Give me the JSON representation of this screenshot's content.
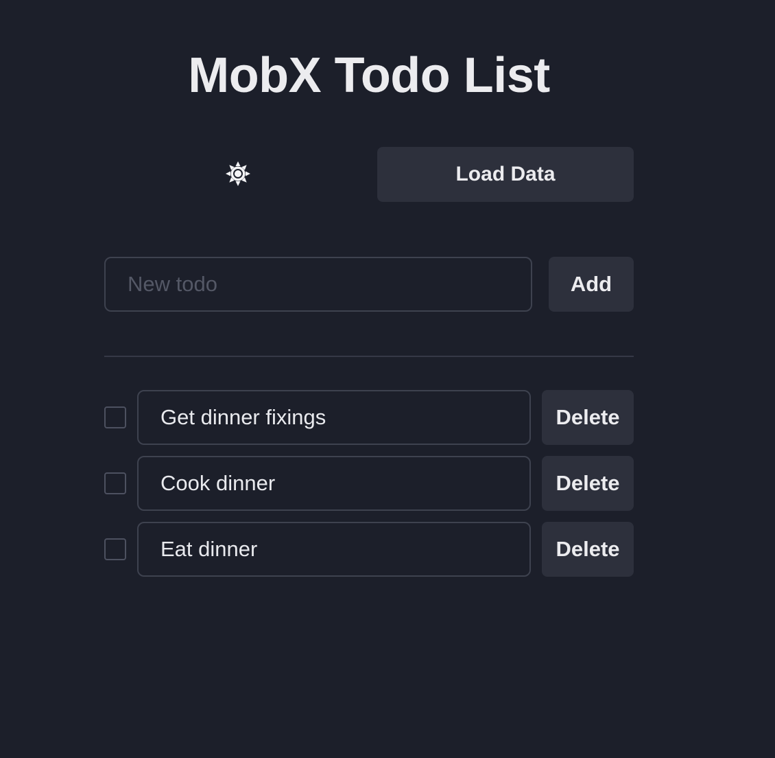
{
  "header": {
    "title": "MobX Todo List"
  },
  "toolbar": {
    "theme_icon": "sun-icon",
    "load_label": "Load Data"
  },
  "new_todo": {
    "value": "",
    "placeholder": "New todo",
    "add_label": "Add"
  },
  "todos": [
    {
      "text": "Get dinner fixings",
      "done": false,
      "delete_label": "Delete"
    },
    {
      "text": "Cook dinner",
      "done": false,
      "delete_label": "Delete"
    },
    {
      "text": "Eat dinner",
      "done": false,
      "delete_label": "Delete"
    }
  ],
  "colors": {
    "background": "#1c1f2a",
    "button": "#2d303c",
    "border": "#3e424f",
    "text": "#ececef",
    "placeholder": "#545866"
  }
}
